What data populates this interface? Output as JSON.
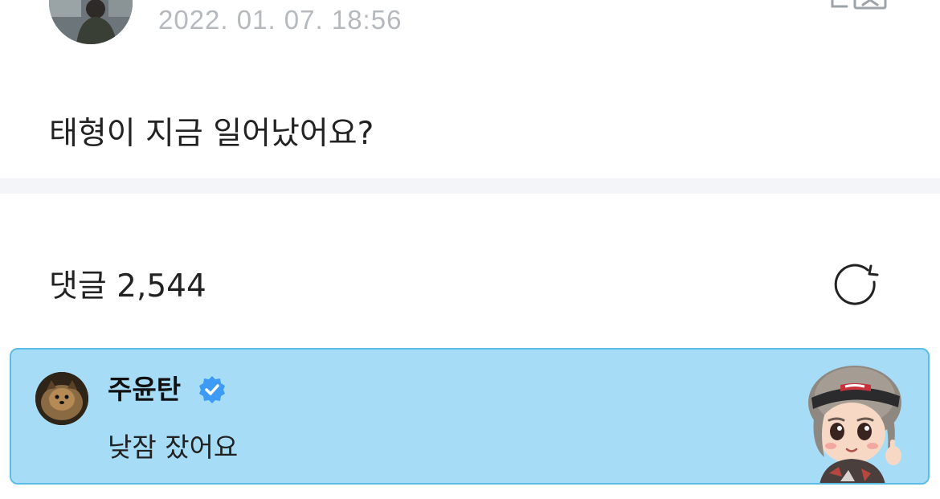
{
  "post": {
    "timestamp": "2022. 01. 07. 18:56",
    "text": "태형이 지금 일어났어요?"
  },
  "comments": {
    "title": "댓글 2,544"
  },
  "highlighted_comment": {
    "author": "주윤탄",
    "verified": true,
    "text": "낮잠 잤어요"
  },
  "icons": {
    "translate": "translate-icon",
    "refresh": "refresh-icon",
    "verified": "verified-badge-icon"
  },
  "colors": {
    "card_background": "#a7dcf6",
    "card_border": "#5bbde6",
    "verified_badge": "#3d9bf5",
    "timestamp_text": "#b5b9bd",
    "divider": "#f4f5f8"
  }
}
